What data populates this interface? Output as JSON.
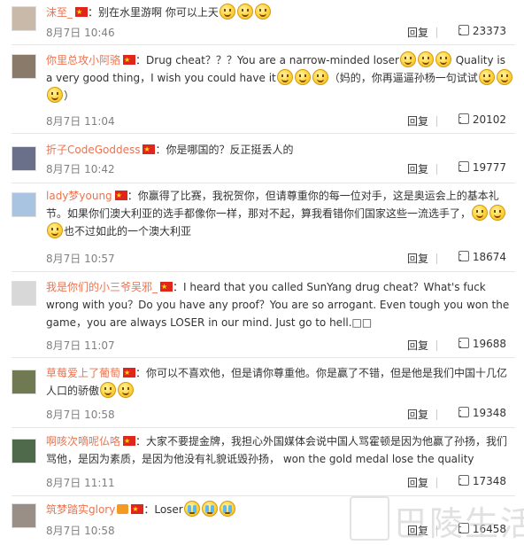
{
  "comments": [
    {
      "username": "沫至_",
      "text_parts": [
        "：别在水里游啊 你可以上天"
      ],
      "time": "8月7日 10:46",
      "reply_label": "回复",
      "likes": "23373",
      "avatar_color": "#c9b9a8"
    },
    {
      "username": "你里总攻小阿骆",
      "text_parts": [
        "：Drug cheat？？？You are a narrow-minded loser",
        " Quality is a very good thing，I wish you could have it",
        "（妈的，你再逼逼孙杨一句试试",
        "）"
      ],
      "time": "8月7日 11:04",
      "reply_label": "回复",
      "likes": "20102",
      "avatar_color": "#8a7a6a"
    },
    {
      "username": "折子CodeGoddess",
      "text_parts": [
        "：你是哪国的？反正挺丢人的"
      ],
      "time": "8月7日 10:42",
      "reply_label": "回复",
      "likes": "19777",
      "avatar_color": "#6a6f8a"
    },
    {
      "username": "lady梦young",
      "text_parts": [
        "：你赢得了比赛，我祝贺你，但请尊重你的每一位对手，这是奥运会上的基本礼节。如果你们澳大利亚的选手都像你一样，那对不起，算我看错你们国家这些一流选手了，",
        "也不过如此的一个澳大利亚"
      ],
      "time": "8月7日 10:57",
      "reply_label": "回复",
      "likes": "18674",
      "avatar_color": "#a9c4e0"
    },
    {
      "username": "我是你们的小三爷吴邪_",
      "text_parts": [
        "：I heard that you called SunYang drug cheat？What's fuck wrong with you？Do you have any proof？You are so arrogant. Even tough you won the game，you are always LOSER in our mind. Just go to hell.□□"
      ],
      "time": "8月7日 11:07",
      "reply_label": "回复",
      "likes": "19688",
      "avatar_color": "#d8d8d8"
    },
    {
      "username": "草莓爱上了葡萄",
      "text_parts": [
        "：你可以不喜欢他，但是请你尊重他。你是赢了不错，但是他是我们中国十几亿人口的骄傲"
      ],
      "time": "8月7日 10:58",
      "reply_label": "回复",
      "likes": "19348",
      "avatar_color": "#6f7a52"
    },
    {
      "username": "啊咳次嘀呢仏咯",
      "text_parts": [
        "：大家不要提金牌，我担心外国媒体会说中国人骂霍顿是因为他赢了孙扬，我们骂他，是因为素质，是因为他没有礼貌诋毁孙扬， won the gold medal lose the quality"
      ],
      "time": "8月7日 11:11",
      "reply_label": "回复",
      "likes": "17348",
      "avatar_color": "#4f6a4a"
    },
    {
      "username": "筑梦踏实glory",
      "text_parts": [
        "：Loser"
      ],
      "time": "8月7日 10:58",
      "reply_label": "回复",
      "likes": "16458",
      "avatar_color": "#9a8f86"
    }
  ],
  "watermark": "巴陵生活网",
  "colors": {
    "username": "#eb7350",
    "time": "#808080",
    "flag": "#e0261b"
  }
}
